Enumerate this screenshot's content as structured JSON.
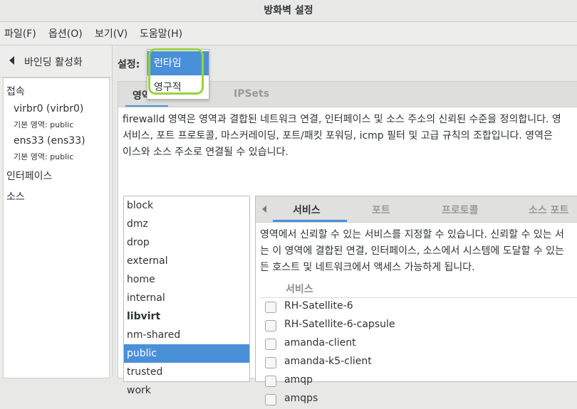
{
  "window": {
    "title": "방화벽 설정"
  },
  "menu": [
    "파일(F)",
    "옵션(O)",
    "보기(V)",
    "도움말(H)"
  ],
  "sidebar": {
    "binding_label": "바인딩 활성화",
    "connections_header": "접속",
    "connections": [
      {
        "name": "virbr0 (virbr0)",
        "zone": "기본 영역: public"
      },
      {
        "name": "ens33 (ens33)",
        "zone": "기본 영역: public"
      }
    ],
    "interfaces_label": "인터페이스",
    "sources_label": "소스"
  },
  "settings": {
    "label": "설정:",
    "options": [
      "런타임",
      "영구적"
    ],
    "selected": "런타임"
  },
  "tabs": [
    "영역",
    "IPSets"
  ],
  "zone_description": "firewalld 영역은 영역과 결합된 네트워크 연결, 인터페이스 및 소스 주소의 신뢰된 수준을 정의합니다. 영\n서비스, 포트 프로토콜, 마스커레이딩, 포트/패킷 포워딩, icmp 필터 및 고급 규칙의 조합입니다. 영역은\n이스와 소스 주소로 연결될 수 있습니다.",
  "zones": [
    "block",
    "dmz",
    "drop",
    "external",
    "home",
    "internal",
    "libvirt",
    "nm-shared",
    "public",
    "trusted",
    "work"
  ],
  "selected_zone": "public",
  "bold_zone": "libvirt",
  "sub_tabs": [
    "서비스",
    "포트",
    "프로토콜",
    "소스 포트"
  ],
  "services_description": "영역에서 신뢰할 수 있는 서비스를 지정할 수 있습니다. 신뢰할 수 있는 서\n는 이 영역에 결합된 연결, 인터페이스, 소스에서 시스템에 도달할 수 있는\n든 호스트 및 네트워크에서 액세스 가능하게 됩니다.",
  "services_header": "서비스",
  "services": [
    {
      "name": "RH-Satellite-6",
      "checked": false
    },
    {
      "name": "RH-Satellite-6-capsule",
      "checked": false
    },
    {
      "name": "amanda-client",
      "checked": false
    },
    {
      "name": "amanda-k5-client",
      "checked": false
    },
    {
      "name": "amqp",
      "checked": false
    },
    {
      "name": "amqps",
      "checked": false
    }
  ],
  "colors": {
    "accent": "#4a90d9",
    "annotation": "#9bd23a"
  }
}
